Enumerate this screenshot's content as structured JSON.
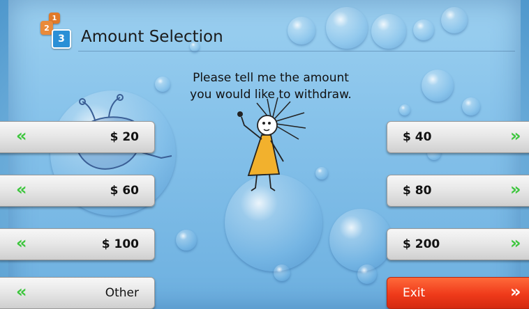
{
  "header": {
    "logo_tiles": [
      "1",
      "2",
      "3"
    ],
    "title": "Amount Selection"
  },
  "prompt": {
    "line1": "Please tell me the amount",
    "line2": "you would like to withdraw."
  },
  "left_buttons": [
    {
      "label": "$ 20"
    },
    {
      "label": "$ 60"
    },
    {
      "label": "$ 100"
    },
    {
      "label": "Other"
    }
  ],
  "right_buttons": [
    {
      "label": "$ 40"
    },
    {
      "label": "$ 80"
    },
    {
      "label": "$ 200"
    },
    {
      "label": "Exit"
    }
  ],
  "arrows": {
    "left": "«",
    "right": "»"
  },
  "colors": {
    "arrow_green": "#3cc63c",
    "exit_red": "#ef3a1a",
    "title_tile_blue": "#2a8fd6",
    "title_tile_orange": "#e07a2a"
  }
}
